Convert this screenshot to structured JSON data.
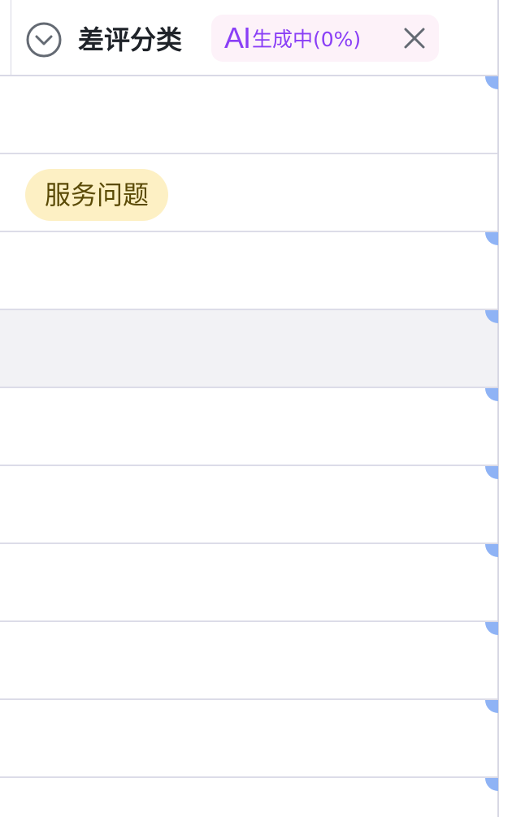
{
  "column": {
    "title": "差评分类",
    "ai": {
      "logo": "AI",
      "status": "生成中(0%)"
    }
  },
  "rows": [
    {
      "tag": ""
    },
    {
      "tag": "服务问题"
    },
    {
      "tag": ""
    },
    {
      "tag": ""
    },
    {
      "tag": ""
    },
    {
      "tag": ""
    },
    {
      "tag": ""
    },
    {
      "tag": ""
    },
    {
      "tag": ""
    },
    {
      "tag": ""
    }
  ],
  "colors": {
    "ai_accent": "#8a3ff6",
    "tag_bg": "#fdf0c4",
    "tag_text": "#5a4a06",
    "row_hover": "#f2f2f5",
    "row_edge": "#8fb3f5"
  },
  "icons": {
    "expand": "chevron-down-circle-icon",
    "cancel": "close-icon"
  }
}
